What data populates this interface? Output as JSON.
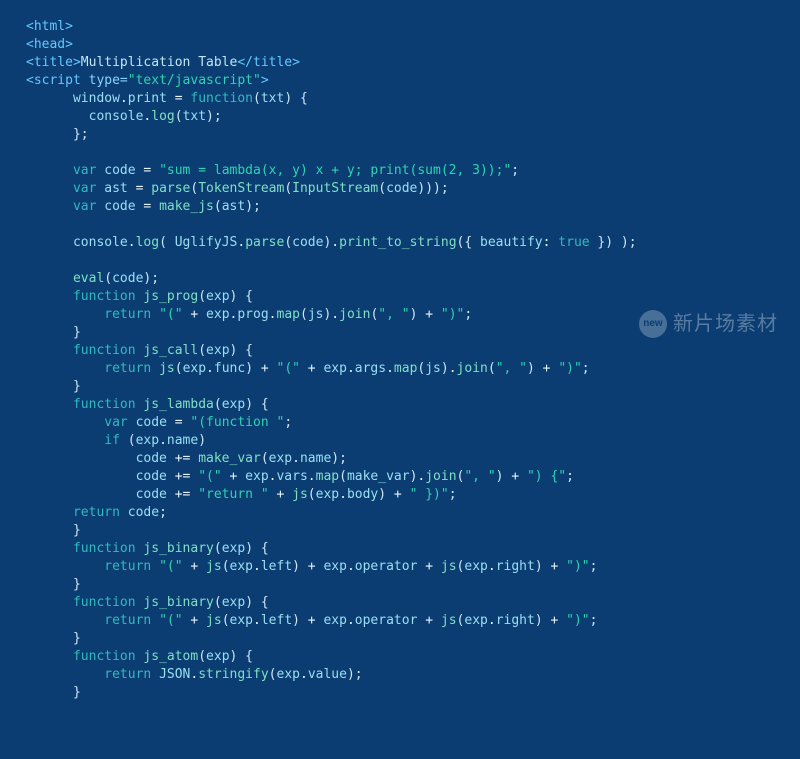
{
  "watermark": {
    "badge": "new",
    "text": "新片场素材"
  },
  "code": {
    "lines": [
      [
        [
          "t-tag",
          "<html>"
        ]
      ],
      [
        [
          "t-tag",
          "<head>"
        ]
      ],
      [
        [
          "t-tag",
          "<title>"
        ],
        [
          "t-plain",
          "Multiplication Table"
        ],
        [
          "t-tag",
          "</title>"
        ]
      ],
      [
        [
          "t-tag",
          "<script "
        ],
        [
          "t-attr",
          "type="
        ],
        [
          "t-str",
          "\"text/javascript\""
        ],
        [
          "t-tag",
          ">"
        ]
      ],
      [
        [
          "t-plain",
          "      "
        ],
        [
          "t-ident",
          "window"
        ],
        [
          "t-op",
          "."
        ],
        [
          "t-ident",
          "print"
        ],
        [
          "t-op",
          " = "
        ],
        [
          "t-key",
          "function"
        ],
        [
          "t-punc",
          "("
        ],
        [
          "t-ident",
          "txt"
        ],
        [
          "t-punc",
          ") {"
        ]
      ],
      [
        [
          "t-plain",
          "        "
        ],
        [
          "t-ident",
          "console"
        ],
        [
          "t-op",
          "."
        ],
        [
          "t-fn",
          "log"
        ],
        [
          "t-punc",
          "("
        ],
        [
          "t-ident",
          "txt"
        ],
        [
          "t-punc",
          ");"
        ]
      ],
      [
        [
          "t-plain",
          "      "
        ],
        [
          "t-punc",
          "};"
        ]
      ],
      [
        [
          "t-plain",
          " "
        ]
      ],
      [
        [
          "t-plain",
          "      "
        ],
        [
          "t-key",
          "var "
        ],
        [
          "t-ident",
          "code"
        ],
        [
          "t-op",
          " = "
        ],
        [
          "t-str",
          "\"sum = lambda(x, y) x + y; print(sum(2, 3));\""
        ],
        [
          "t-punc",
          ";"
        ]
      ],
      [
        [
          "t-plain",
          "      "
        ],
        [
          "t-key",
          "var "
        ],
        [
          "t-ident",
          "ast"
        ],
        [
          "t-op",
          " = "
        ],
        [
          "t-fn",
          "parse"
        ],
        [
          "t-punc",
          "("
        ],
        [
          "t-fn",
          "TokenStream"
        ],
        [
          "t-punc",
          "("
        ],
        [
          "t-fn",
          "InputStream"
        ],
        [
          "t-punc",
          "("
        ],
        [
          "t-ident",
          "code"
        ],
        [
          "t-punc",
          ")));"
        ]
      ],
      [
        [
          "t-plain",
          "      "
        ],
        [
          "t-key",
          "var "
        ],
        [
          "t-ident",
          "code"
        ],
        [
          "t-op",
          " = "
        ],
        [
          "t-fn",
          "make_js"
        ],
        [
          "t-punc",
          "("
        ],
        [
          "t-ident",
          "ast"
        ],
        [
          "t-punc",
          ");"
        ]
      ],
      [
        [
          "t-plain",
          " "
        ]
      ],
      [
        [
          "t-plain",
          "      "
        ],
        [
          "t-ident",
          "console"
        ],
        [
          "t-op",
          "."
        ],
        [
          "t-fn",
          "log"
        ],
        [
          "t-punc",
          "( "
        ],
        [
          "t-ident",
          "UglifyJS"
        ],
        [
          "t-op",
          "."
        ],
        [
          "t-fn",
          "parse"
        ],
        [
          "t-punc",
          "("
        ],
        [
          "t-ident",
          "code"
        ],
        [
          "t-punc",
          ")"
        ],
        [
          "t-op",
          "."
        ],
        [
          "t-fn",
          "print_to_string"
        ],
        [
          "t-punc",
          "({ "
        ],
        [
          "t-ident",
          "beautify"
        ],
        [
          "t-op",
          ": "
        ],
        [
          "t-key",
          "true"
        ],
        [
          "t-punc",
          " }) );"
        ]
      ],
      [
        [
          "t-plain",
          " "
        ]
      ],
      [
        [
          "t-plain",
          "      "
        ],
        [
          "t-fn",
          "eval"
        ],
        [
          "t-punc",
          "("
        ],
        [
          "t-ident",
          "code"
        ],
        [
          "t-punc",
          ");"
        ]
      ],
      [
        [
          "t-plain",
          "      "
        ],
        [
          "t-key",
          "function "
        ],
        [
          "t-fn",
          "js_prog"
        ],
        [
          "t-punc",
          "("
        ],
        [
          "t-ident",
          "exp"
        ],
        [
          "t-punc",
          ") {"
        ]
      ],
      [
        [
          "t-plain",
          "          "
        ],
        [
          "t-key",
          "return "
        ],
        [
          "t-str",
          "\"(\""
        ],
        [
          "t-op",
          " + "
        ],
        [
          "t-ident",
          "exp"
        ],
        [
          "t-op",
          "."
        ],
        [
          "t-ident",
          "prog"
        ],
        [
          "t-op",
          "."
        ],
        [
          "t-fn",
          "map"
        ],
        [
          "t-punc",
          "("
        ],
        [
          "t-ident",
          "js"
        ],
        [
          "t-punc",
          ")"
        ],
        [
          "t-op",
          "."
        ],
        [
          "t-fn",
          "join"
        ],
        [
          "t-punc",
          "("
        ],
        [
          "t-str",
          "\", \""
        ],
        [
          "t-punc",
          ")"
        ],
        [
          "t-op",
          " + "
        ],
        [
          "t-str",
          "\")\""
        ],
        [
          "t-punc",
          ";"
        ]
      ],
      [
        [
          "t-plain",
          "      "
        ],
        [
          "t-punc",
          "}"
        ]
      ],
      [
        [
          "t-plain",
          "      "
        ],
        [
          "t-key",
          "function "
        ],
        [
          "t-fn",
          "js_call"
        ],
        [
          "t-punc",
          "("
        ],
        [
          "t-ident",
          "exp"
        ],
        [
          "t-punc",
          ") {"
        ]
      ],
      [
        [
          "t-plain",
          "          "
        ],
        [
          "t-key",
          "return "
        ],
        [
          "t-fn",
          "js"
        ],
        [
          "t-punc",
          "("
        ],
        [
          "t-ident",
          "exp"
        ],
        [
          "t-op",
          "."
        ],
        [
          "t-ident",
          "func"
        ],
        [
          "t-punc",
          ")"
        ],
        [
          "t-op",
          " + "
        ],
        [
          "t-str",
          "\"(\""
        ],
        [
          "t-op",
          " + "
        ],
        [
          "t-ident",
          "exp"
        ],
        [
          "t-op",
          "."
        ],
        [
          "t-ident",
          "args"
        ],
        [
          "t-op",
          "."
        ],
        [
          "t-fn",
          "map"
        ],
        [
          "t-punc",
          "("
        ],
        [
          "t-ident",
          "js"
        ],
        [
          "t-punc",
          ")"
        ],
        [
          "t-op",
          "."
        ],
        [
          "t-fn",
          "join"
        ],
        [
          "t-punc",
          "("
        ],
        [
          "t-str",
          "\", \""
        ],
        [
          "t-punc",
          ")"
        ],
        [
          "t-op",
          " + "
        ],
        [
          "t-str",
          "\")\""
        ],
        [
          "t-punc",
          ";"
        ]
      ],
      [
        [
          "t-plain",
          "      "
        ],
        [
          "t-punc",
          "}"
        ]
      ],
      [
        [
          "t-plain",
          "      "
        ],
        [
          "t-key",
          "function "
        ],
        [
          "t-fn",
          "js_lambda"
        ],
        [
          "t-punc",
          "("
        ],
        [
          "t-ident",
          "exp"
        ],
        [
          "t-punc",
          ") {"
        ]
      ],
      [
        [
          "t-plain",
          "          "
        ],
        [
          "t-key",
          "var "
        ],
        [
          "t-ident",
          "code"
        ],
        [
          "t-op",
          " = "
        ],
        [
          "t-str",
          "\"(function \""
        ],
        [
          "t-punc",
          ";"
        ]
      ],
      [
        [
          "t-plain",
          "          "
        ],
        [
          "t-key",
          "if "
        ],
        [
          "t-punc",
          "("
        ],
        [
          "t-ident",
          "exp"
        ],
        [
          "t-op",
          "."
        ],
        [
          "t-ident",
          "name"
        ],
        [
          "t-punc",
          ")"
        ]
      ],
      [
        [
          "t-plain",
          "              "
        ],
        [
          "t-ident",
          "code"
        ],
        [
          "t-op",
          " += "
        ],
        [
          "t-fn",
          "make_var"
        ],
        [
          "t-punc",
          "("
        ],
        [
          "t-ident",
          "exp"
        ],
        [
          "t-op",
          "."
        ],
        [
          "t-ident",
          "name"
        ],
        [
          "t-punc",
          ");"
        ]
      ],
      [
        [
          "t-plain",
          "              "
        ],
        [
          "t-ident",
          "code"
        ],
        [
          "t-op",
          " += "
        ],
        [
          "t-str",
          "\"(\""
        ],
        [
          "t-op",
          " + "
        ],
        [
          "t-ident",
          "exp"
        ],
        [
          "t-op",
          "."
        ],
        [
          "t-ident",
          "vars"
        ],
        [
          "t-op",
          "."
        ],
        [
          "t-fn",
          "map"
        ],
        [
          "t-punc",
          "("
        ],
        [
          "t-ident",
          "make_var"
        ],
        [
          "t-punc",
          ")"
        ],
        [
          "t-op",
          "."
        ],
        [
          "t-fn",
          "join"
        ],
        [
          "t-punc",
          "("
        ],
        [
          "t-str",
          "\", \""
        ],
        [
          "t-punc",
          ")"
        ],
        [
          "t-op",
          " + "
        ],
        [
          "t-str",
          "\") {\""
        ],
        [
          "t-punc",
          ";"
        ]
      ],
      [
        [
          "t-plain",
          "              "
        ],
        [
          "t-ident",
          "code"
        ],
        [
          "t-op",
          " += "
        ],
        [
          "t-str",
          "\"return \""
        ],
        [
          "t-op",
          " + "
        ],
        [
          "t-fn",
          "js"
        ],
        [
          "t-punc",
          "("
        ],
        [
          "t-ident",
          "exp"
        ],
        [
          "t-op",
          "."
        ],
        [
          "t-ident",
          "body"
        ],
        [
          "t-punc",
          ")"
        ],
        [
          "t-op",
          " + "
        ],
        [
          "t-str",
          "\" })\""
        ],
        [
          "t-punc",
          ";"
        ]
      ],
      [
        [
          "t-plain",
          "      "
        ],
        [
          "t-key",
          "return "
        ],
        [
          "t-ident",
          "code"
        ],
        [
          "t-punc",
          ";"
        ]
      ],
      [
        [
          "t-plain",
          "      "
        ],
        [
          "t-punc",
          "}"
        ]
      ],
      [
        [
          "t-plain",
          "      "
        ],
        [
          "t-key",
          "function "
        ],
        [
          "t-fn",
          "js_binary"
        ],
        [
          "t-punc",
          "("
        ],
        [
          "t-ident",
          "exp"
        ],
        [
          "t-punc",
          ") {"
        ]
      ],
      [
        [
          "t-plain",
          "          "
        ],
        [
          "t-key",
          "return "
        ],
        [
          "t-str",
          "\"(\""
        ],
        [
          "t-op",
          " + "
        ],
        [
          "t-fn",
          "js"
        ],
        [
          "t-punc",
          "("
        ],
        [
          "t-ident",
          "exp"
        ],
        [
          "t-op",
          "."
        ],
        [
          "t-ident",
          "left"
        ],
        [
          "t-punc",
          ")"
        ],
        [
          "t-op",
          " + "
        ],
        [
          "t-ident",
          "exp"
        ],
        [
          "t-op",
          "."
        ],
        [
          "t-ident",
          "operator"
        ],
        [
          "t-op",
          " + "
        ],
        [
          "t-fn",
          "js"
        ],
        [
          "t-punc",
          "("
        ],
        [
          "t-ident",
          "exp"
        ],
        [
          "t-op",
          "."
        ],
        [
          "t-ident",
          "right"
        ],
        [
          "t-punc",
          ")"
        ],
        [
          "t-op",
          " + "
        ],
        [
          "t-str",
          "\")\""
        ],
        [
          "t-punc",
          ";"
        ]
      ],
      [
        [
          "t-plain",
          "      "
        ],
        [
          "t-punc",
          "}"
        ]
      ],
      [
        [
          "t-plain",
          "      "
        ],
        [
          "t-key",
          "function "
        ],
        [
          "t-fn",
          "js_binary"
        ],
        [
          "t-punc",
          "("
        ],
        [
          "t-ident",
          "exp"
        ],
        [
          "t-punc",
          ") {"
        ]
      ],
      [
        [
          "t-plain",
          "          "
        ],
        [
          "t-key",
          "return "
        ],
        [
          "t-str",
          "\"(\""
        ],
        [
          "t-op",
          " + "
        ],
        [
          "t-fn",
          "js"
        ],
        [
          "t-punc",
          "("
        ],
        [
          "t-ident",
          "exp"
        ],
        [
          "t-op",
          "."
        ],
        [
          "t-ident",
          "left"
        ],
        [
          "t-punc",
          ")"
        ],
        [
          "t-op",
          " + "
        ],
        [
          "t-ident",
          "exp"
        ],
        [
          "t-op",
          "."
        ],
        [
          "t-ident",
          "operator"
        ],
        [
          "t-op",
          " + "
        ],
        [
          "t-fn",
          "js"
        ],
        [
          "t-punc",
          "("
        ],
        [
          "t-ident",
          "exp"
        ],
        [
          "t-op",
          "."
        ],
        [
          "t-ident",
          "right"
        ],
        [
          "t-punc",
          ")"
        ],
        [
          "t-op",
          " + "
        ],
        [
          "t-str",
          "\")\""
        ],
        [
          "t-punc",
          ";"
        ]
      ],
      [
        [
          "t-plain",
          "      "
        ],
        [
          "t-punc",
          "}"
        ]
      ],
      [
        [
          "t-plain",
          "      "
        ],
        [
          "t-key",
          "function "
        ],
        [
          "t-fn",
          "js_atom"
        ],
        [
          "t-punc",
          "("
        ],
        [
          "t-ident",
          "exp"
        ],
        [
          "t-punc",
          ") {"
        ]
      ],
      [
        [
          "t-plain",
          "          "
        ],
        [
          "t-key",
          "return "
        ],
        [
          "t-ident",
          "JSON"
        ],
        [
          "t-op",
          "."
        ],
        [
          "t-fn",
          "stringify"
        ],
        [
          "t-punc",
          "("
        ],
        [
          "t-ident",
          "exp"
        ],
        [
          "t-op",
          "."
        ],
        [
          "t-ident",
          "value"
        ],
        [
          "t-punc",
          ");"
        ]
      ],
      [
        [
          "t-plain",
          "      "
        ],
        [
          "t-punc",
          "}"
        ]
      ]
    ]
  }
}
